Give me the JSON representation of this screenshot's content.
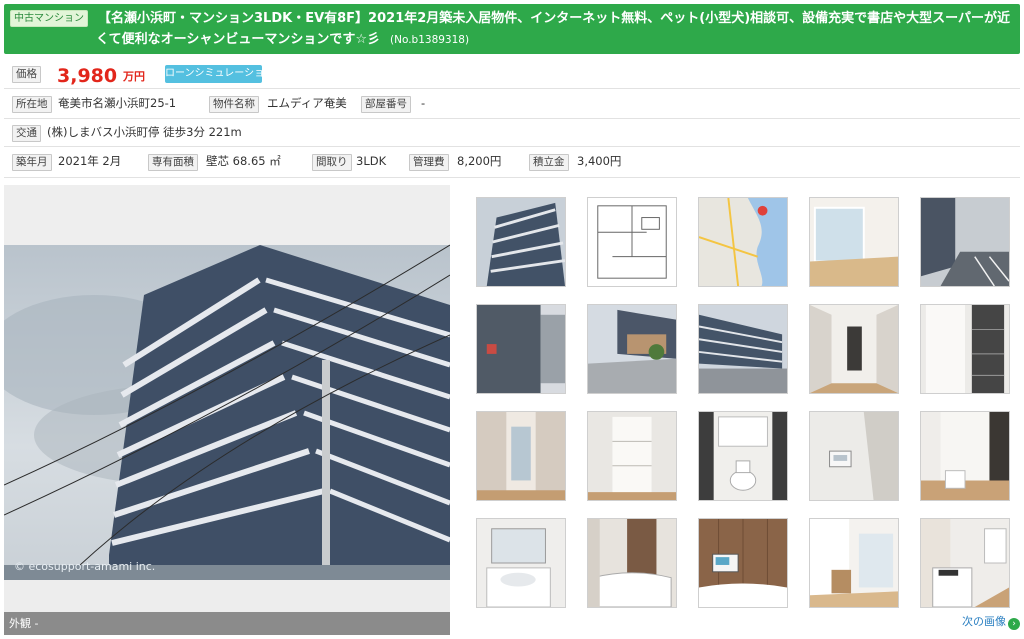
{
  "header": {
    "type_badge": "中古マンション",
    "title": "【名瀬小浜町・マンション3LDK・EV有8F】2021年2月築未入居物件、インターネット無料、ペット(小型犬)相談可、設備充実で書店や大型スーパーが近くて便利なオーシャンビューマンションです☆彡",
    "property_no": "(No.b1389318)"
  },
  "price": {
    "label": "価格",
    "value": "3,980",
    "unit": "万円",
    "loan_button": "ローンシミュレーション"
  },
  "location": {
    "address_label": "所在地",
    "address": "奄美市名瀬小浜町25-1",
    "name_label": "物件名称",
    "name": "エムディア奄美",
    "room_label": "部屋番号",
    "room": "-"
  },
  "transport": {
    "label": "交通",
    "value": "(株)しまバス小浜町停  徒歩3分 221m"
  },
  "specs": {
    "built_label": "築年月",
    "built": "2021年 2月",
    "area_label": "専有面積",
    "area": "壁芯 68.65 ㎡",
    "layout_label": "間取り",
    "layout": "3LDK",
    "fee_label": "管理費",
    "fee": "8,200円",
    "reserve_label": "積立金",
    "reserve": "3,400円"
  },
  "gallery": {
    "main_watermark": "© ecosupport-amami inc.",
    "caption": "外観 -",
    "next_label": "次の画像",
    "next_icon": "arrow-right-circle-icon",
    "thumbnails": [
      {
        "name": "thumb-exterior"
      },
      {
        "name": "thumb-floor-plan"
      },
      {
        "name": "thumb-map"
      },
      {
        "name": "thumb-living-room"
      },
      {
        "name": "thumb-parking"
      },
      {
        "name": "thumb-entrance"
      },
      {
        "name": "thumb-building-front"
      },
      {
        "name": "thumb-building-side"
      },
      {
        "name": "thumb-hallway"
      },
      {
        "name": "thumb-closet"
      },
      {
        "name": "thumb-room-door"
      },
      {
        "name": "thumb-storage"
      },
      {
        "name": "thumb-toilet"
      },
      {
        "name": "thumb-intercom"
      },
      {
        "name": "thumb-room-corner"
      },
      {
        "name": "thumb-washbasin"
      },
      {
        "name": "thumb-bathroom"
      },
      {
        "name": "thumb-bath-panel"
      },
      {
        "name": "thumb-dining"
      },
      {
        "name": "thumb-kitchen"
      }
    ]
  },
  "colors": {
    "header_green": "#2ea94a",
    "price_red": "#e2261b",
    "button_blue": "#54c0e0",
    "link_blue": "#2a7fc1"
  }
}
